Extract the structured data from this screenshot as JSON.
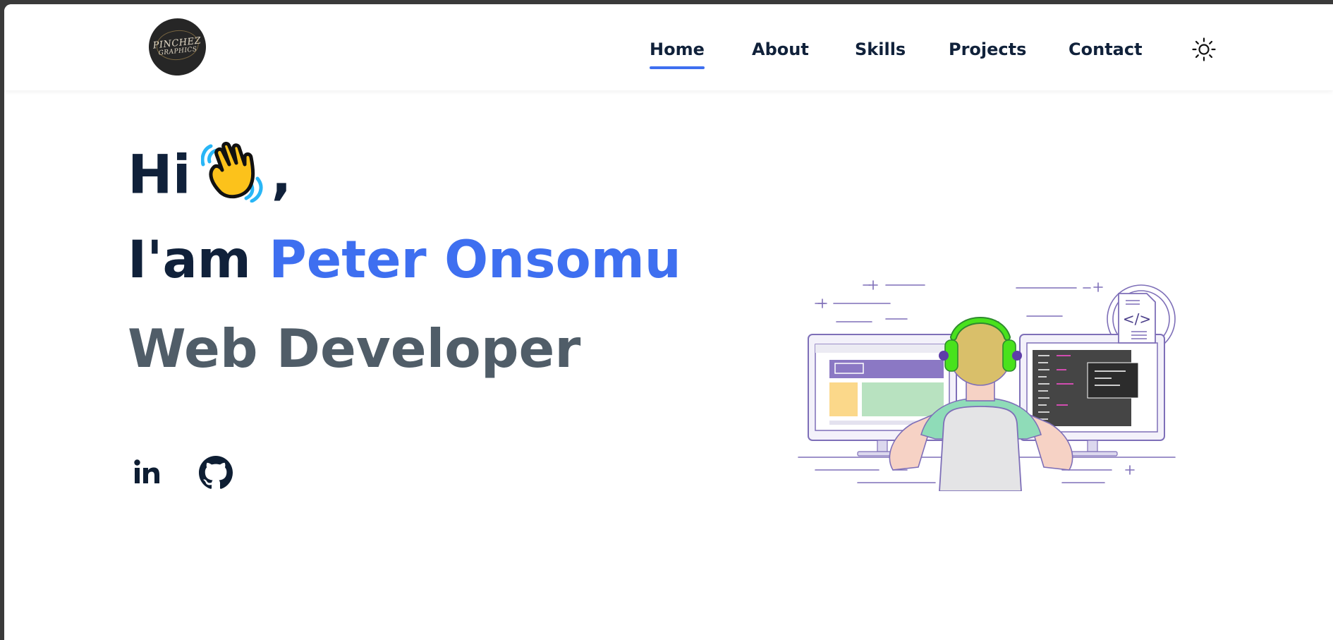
{
  "logo": {
    "line1": "PINCHEZ",
    "line2": "GRAPHICS"
  },
  "nav": {
    "items": [
      {
        "label": "Home",
        "active": true
      },
      {
        "label": "About",
        "active": false
      },
      {
        "label": "Skills",
        "active": false
      },
      {
        "label": "Projects",
        "active": false
      },
      {
        "label": "Contact",
        "active": false
      }
    ],
    "theme_icon": "sun-icon"
  },
  "hero": {
    "greeting": "Hi",
    "greeting_emoji": "waving-hand-emoji",
    "greeting_punct": ",",
    "intro": "I'am",
    "name": "Peter Onsomu",
    "role": "Web Developer"
  },
  "social": [
    {
      "icon": "linkedin-icon",
      "label": "in"
    },
    {
      "icon": "github-icon"
    }
  ],
  "illustration": {
    "icon": "developer-at-desk-illustration",
    "code_tag": "</>"
  },
  "colors": {
    "accent": "#3e6ff0",
    "heading": "#10213a",
    "role": "#505d68",
    "background": "#ffffff",
    "window_border": "#3a3a3a"
  }
}
